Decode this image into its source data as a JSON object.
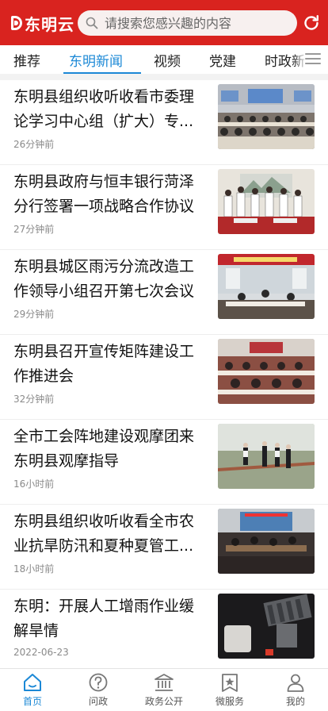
{
  "header": {
    "logo_text": "东明云",
    "search_placeholder": "请搜索您感兴趣的内容",
    "brand_color": "#d9231f"
  },
  "tabs": [
    {
      "label": "推荐",
      "active": false
    },
    {
      "label": "东明新闻",
      "active": true
    },
    {
      "label": "视频",
      "active": false
    },
    {
      "label": "党建",
      "active": false
    },
    {
      "label": "时政新",
      "active": false
    }
  ],
  "news": [
    {
      "title": "东明县组织收听收看市委理论学习中心组（扩大）专...",
      "time": "26分钟前",
      "thumb": "meeting-hall-photo"
    },
    {
      "title": "东明县政府与恒丰银行菏泽分行签署一项战略合作协议",
      "time": "27分钟前",
      "thumb": "signing-ceremony-photo"
    },
    {
      "title": "东明县城区雨污分流改造工作领导小组召开第七次会议",
      "time": "29分钟前",
      "thumb": "banner-meeting-photo"
    },
    {
      "title": "东明县召开宣传矩阵建设工作推进会",
      "time": "32分钟前",
      "thumb": "conference-room-photo"
    },
    {
      "title": "全市工会阵地建设观摩团来东明县观摩指导",
      "time": "16小时前",
      "thumb": "outdoor-inspection-photo"
    },
    {
      "title": "东明县组织收听收看全市农业抗旱防汛和夏种夏管工...",
      "time": "18小时前",
      "thumb": "screen-meeting-photo"
    },
    {
      "title": "东明：开展人工增雨作业缓解旱情",
      "time": "2022-06-23",
      "thumb": "rocket-launcher-photo"
    }
  ],
  "bottom_nav": [
    {
      "label": "首页",
      "icon": "home-icon",
      "active": true
    },
    {
      "label": "问政",
      "icon": "question-icon",
      "active": false
    },
    {
      "label": "政务公开",
      "icon": "government-building-icon",
      "active": false
    },
    {
      "label": "微服务",
      "icon": "star-badge-icon",
      "active": false
    },
    {
      "label": "我的",
      "icon": "user-icon",
      "active": false
    }
  ],
  "accent_color": "#1b88d6"
}
